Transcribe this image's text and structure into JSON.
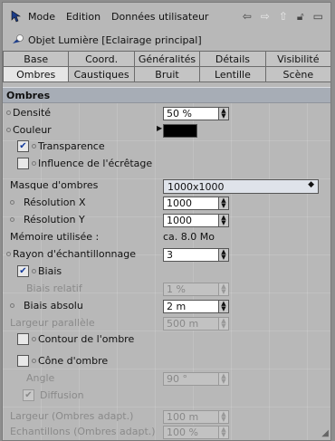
{
  "menu": {
    "mode": "Mode",
    "edition": "Edition",
    "user_data": "Données utilisateur"
  },
  "object_title": "Objet Lumière [Eclairage principal]",
  "tabs_row1": [
    "Base",
    "Coord.",
    "Généralités",
    "Détails",
    "Visibilité"
  ],
  "tabs_row2": [
    "Ombres",
    "Caustiques",
    "Bruit",
    "Lentille",
    "Scène"
  ],
  "section_title": "Ombres",
  "density": {
    "label": "Densité",
    "value": "50 %"
  },
  "color": {
    "label": "Couleur",
    "value_hex": "#000000"
  },
  "transparency": {
    "label": "Transparence",
    "checked": true
  },
  "clipping": {
    "label": "Influence de l'écrêtage",
    "checked": false
  },
  "shadow_map": {
    "label": "Masque d'ombres",
    "value": "1000x1000"
  },
  "res_x": {
    "label": "Résolution X",
    "value": "1000"
  },
  "res_y": {
    "label": "Résolution Y",
    "value": "1000"
  },
  "memory": {
    "label": "Mémoire utilisée :",
    "value": "ca. 8.0 Mo"
  },
  "sample_radius": {
    "label": "Rayon d'échantillonnage",
    "value": "3"
  },
  "bias": {
    "label": "Biais",
    "checked": true
  },
  "bias_relative": {
    "label": "Biais relatif",
    "value": "1 %"
  },
  "bias_absolute": {
    "label": "Biais absolu",
    "value": "2 m"
  },
  "parallel_width": {
    "label": "Largeur parallèle",
    "value": "500 m"
  },
  "outline": {
    "label": "Contour de l'ombre",
    "checked": false
  },
  "shadow_cone": {
    "label": "Cône d'ombre",
    "checked": false
  },
  "angle": {
    "label": "Angle",
    "value": "90 °"
  },
  "diffusion": {
    "label": "Diffusion",
    "checked": true
  },
  "adapt_width": {
    "label": "Largeur (Ombres adapt.)",
    "value": "100 m"
  },
  "adapt_samples": {
    "label": "Echantillons (Ombres adapt.)",
    "value": "100 %"
  }
}
